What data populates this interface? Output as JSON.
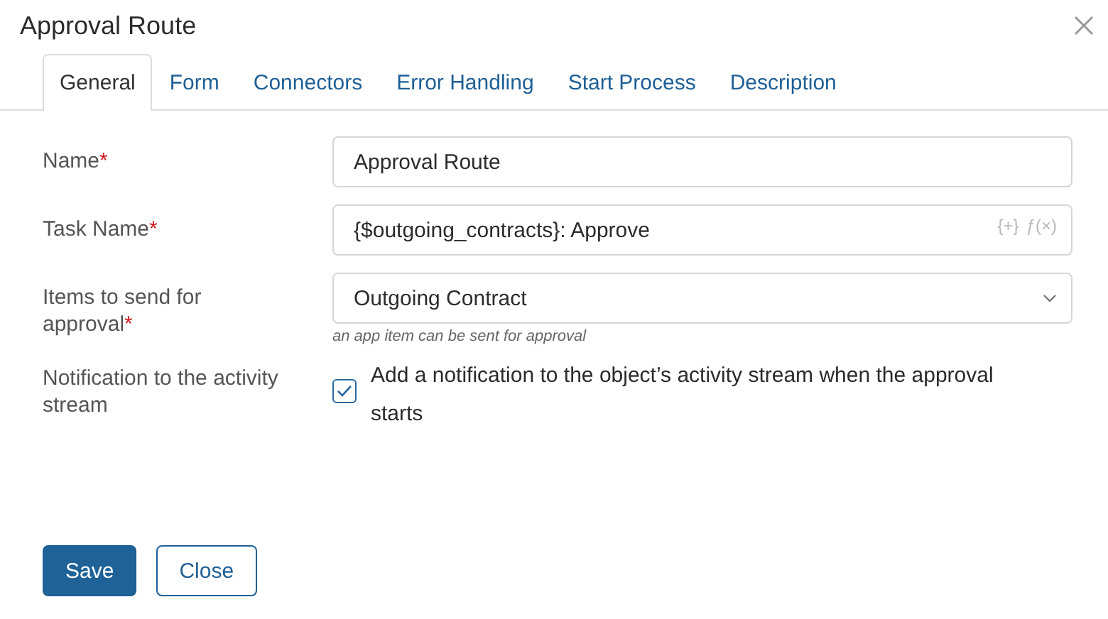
{
  "window": {
    "title": "Approval Route"
  },
  "tabs": [
    {
      "label": "General",
      "selected": true
    },
    {
      "label": "Form",
      "selected": false
    },
    {
      "label": "Connectors",
      "selected": false
    },
    {
      "label": "Error Handling",
      "selected": false
    },
    {
      "label": "Start Process",
      "selected": false
    },
    {
      "label": "Description",
      "selected": false
    }
  ],
  "fields": [
    {
      "kind": "text",
      "label": "Name",
      "required_mark": "*",
      "value": "Approval Route"
    },
    {
      "kind": "text",
      "label": "Task Name",
      "required_mark": "*",
      "value": "{$outgoing_contracts}: Approve",
      "actions": [
        "{+}",
        "ƒ(×)"
      ]
    },
    {
      "kind": "select",
      "label": "Items to send for approval",
      "required_mark": "*",
      "value": "Outgoing Contract",
      "hint": "an app item can be sent for approval"
    },
    {
      "kind": "checkbox",
      "label": "Notification to the activity stream",
      "checked": true,
      "text": "Add a notification to the object’s activity stream when the approval starts"
    }
  ],
  "buttons": [
    {
      "label": "Save",
      "kind": "primary"
    },
    {
      "label": "Close",
      "kind": "secondary"
    }
  ]
}
